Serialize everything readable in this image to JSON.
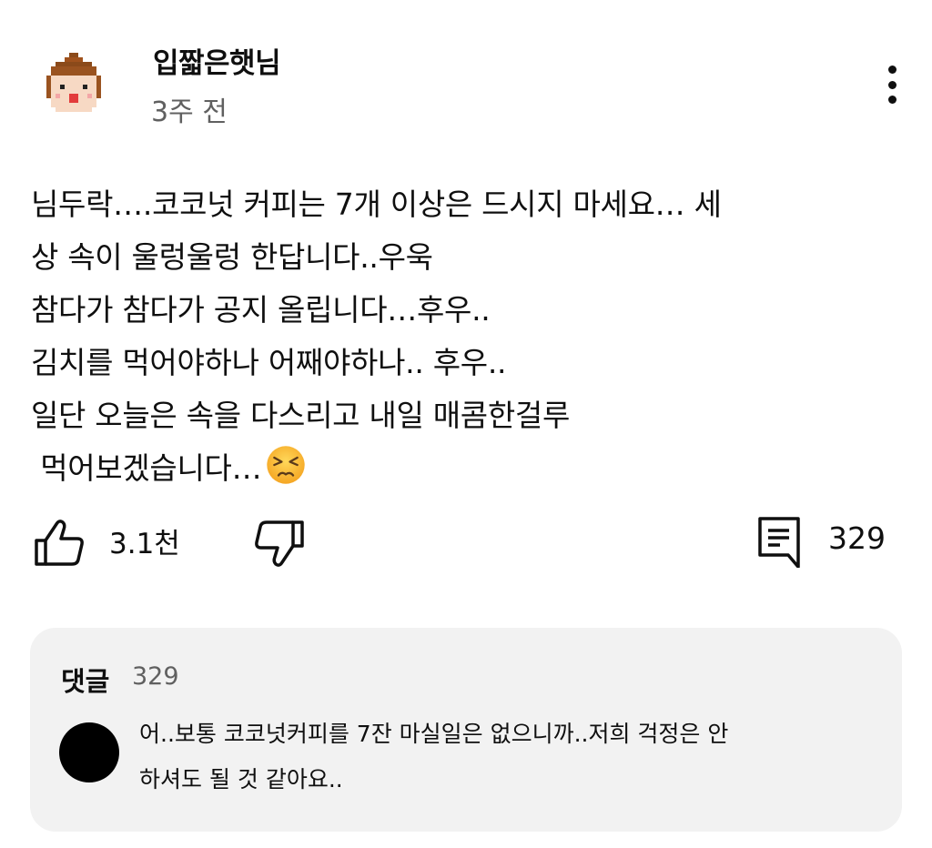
{
  "comment": {
    "author": "입짧은햇님",
    "time": "3주 전",
    "body_lines": [
      "님두락….코코넛 커피는 7개 이상은 드시지 마세요… 세",
      "상 속이 울렁울렁 한답니다..우욱",
      "참다가 참다가 공지 올립니다…후우..",
      "김치를 먹어야하나 어째야하나.. 후우..",
      "일단 오늘은 속을 다스리고 내일 매콤한걸루",
      " 먹어보겠습니다…"
    ],
    "emoji": "persevering-face-emoji"
  },
  "actions": {
    "like_count": "3.1천",
    "reply_count": "329"
  },
  "replies": {
    "title": "댓글",
    "count": "329",
    "preview_lines": [
      "어..보통 코코넛커피를 7잔 마실일은 없으니까..저희 걱정은 안",
      "하셔도 될 것 같아요.."
    ]
  },
  "icons": {
    "avatar": "pixel-character-avatar",
    "more": "more-vertical-icon",
    "like": "thumbs-up-icon",
    "dislike": "thumbs-down-icon",
    "reply": "comment-icon"
  },
  "colors": {
    "text_primary": "#0f0f0f",
    "text_secondary": "#606060",
    "panel_bg": "#f2f2f2"
  }
}
